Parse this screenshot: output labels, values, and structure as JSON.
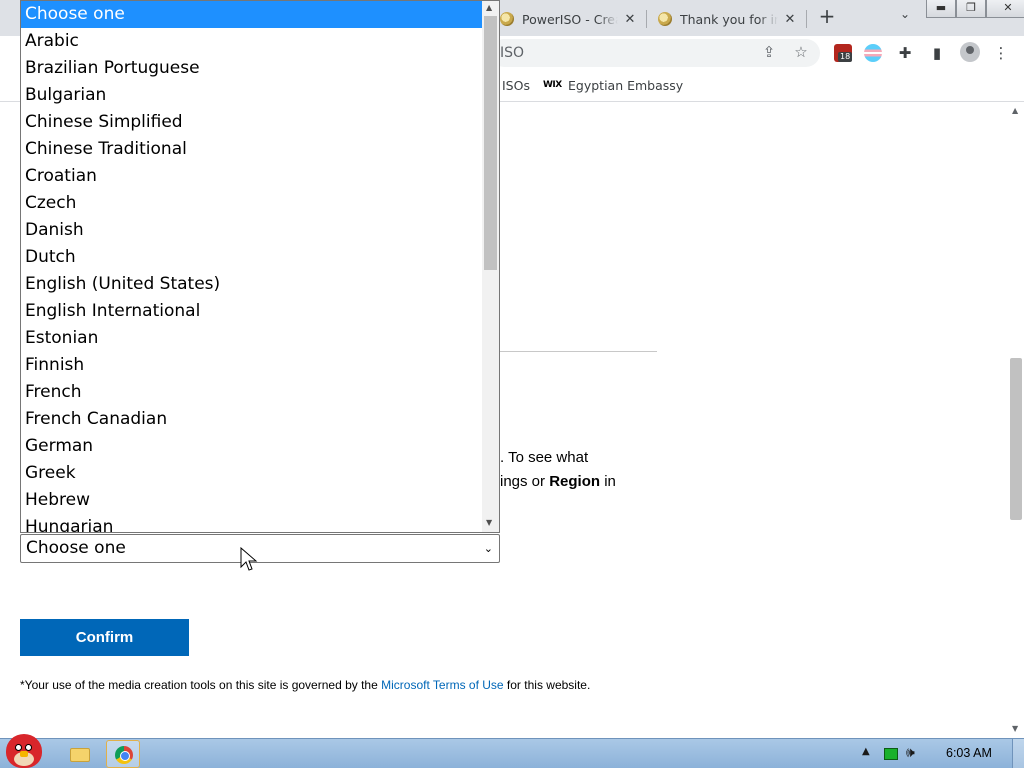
{
  "browser": {
    "tabs": [
      {
        "title": "PowerISO - Crea"
      },
      {
        "title": "Thank you for in"
      }
    ],
    "new_tab": "+",
    "tab_search": "⌄",
    "window_controls": {
      "minimize": "▬",
      "maximize": "❐",
      "close": "✕"
    },
    "address_bar": {
      "value": "ISO"
    },
    "extension_badge": "18",
    "bookmarks": [
      {
        "label": "ISOs"
      },
      {
        "label": "Egyptian Embassy",
        "icon_label": "WIX"
      }
    ]
  },
  "page": {
    "paragraph_line1": ". To see what",
    "paragraph_line2_pre": "ings or ",
    "paragraph_line2_bold": "Region",
    "paragraph_line2_post": " in",
    "language_select": {
      "selected_value": "Choose one",
      "options": [
        "Choose one",
        "Arabic",
        "Brazilian Portuguese",
        "Bulgarian",
        "Chinese Simplified",
        "Chinese Traditional",
        "Croatian",
        "Czech",
        "Danish",
        "Dutch",
        "English (United States)",
        "English International",
        "Estonian",
        "Finnish",
        "French",
        "French Canadian",
        "German",
        "Greek",
        "Hebrew",
        "Hungarian"
      ],
      "highlighted_index": 0
    },
    "confirm_button": "Confirm",
    "terms": {
      "prefix": "*Your use of the media creation tools on this site is governed by the ",
      "link": "Microsoft Terms of Use",
      "suffix": " for this website."
    }
  },
  "taskbar": {
    "clock": "6:03 AM",
    "tray_arrow": "▲",
    "volume_icon": "🕪"
  },
  "colors": {
    "accent": "#0067b8",
    "option_highlight": "#1e90ff",
    "taskbar": "#9dbfe2"
  }
}
